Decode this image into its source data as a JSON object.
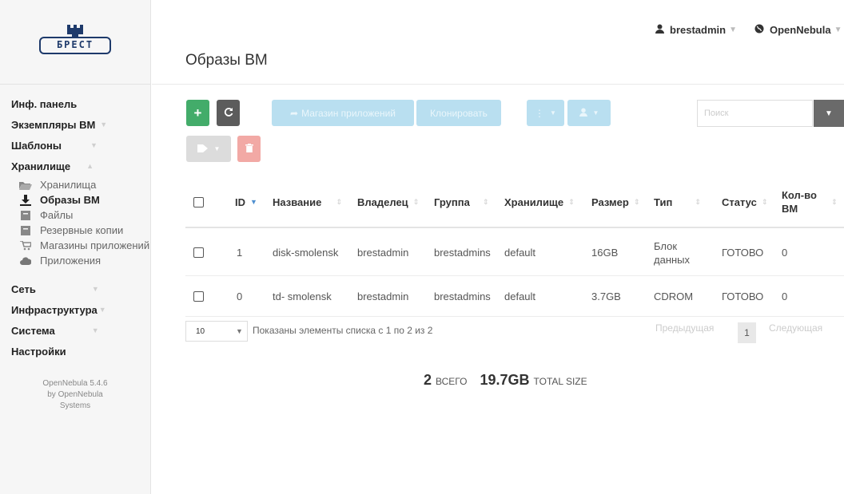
{
  "sidebar": {
    "logo_text": "БРЕСТ",
    "menu": {
      "dashboard": "Инф. панель",
      "vms": "Экземпляры ВМ",
      "templates": "Шаблоны",
      "storage": "Хранилище",
      "network": "Сеть",
      "infrastructure": "Инфраструктура",
      "system": "Система",
      "settings": "Настройки"
    },
    "storage_items": [
      {
        "label": "Хранилища",
        "icon": "folder-open-icon"
      },
      {
        "label": "Образы ВМ",
        "icon": "download-icon"
      },
      {
        "label": "Файлы",
        "icon": "file-icon"
      },
      {
        "label": "Резервные копии",
        "icon": "backup-icon"
      },
      {
        "label": "Магазины приложений",
        "icon": "cart-icon"
      },
      {
        "label": "Приложения",
        "icon": "cloud-icon"
      }
    ],
    "footer": {
      "line1": "OpenNebula 5.4.6",
      "line2": "by OpenNebula",
      "line3": "Systems"
    }
  },
  "header": {
    "title": "Образы ВМ",
    "user": "brestadmin",
    "zone": "OpenNebula"
  },
  "toolbar": {
    "create_label": "+",
    "marketplace_label": "Магазин приложений",
    "clone_label": "Клонировать",
    "search_placeholder": "Поиск"
  },
  "table": {
    "columns": {
      "id": "ID",
      "name": "Название",
      "owner": "Владелец",
      "group": "Группа",
      "datastore": "Хранилище",
      "size": "Размер",
      "type": "Тип",
      "status": "Статус",
      "vms": "Кол-во ВМ"
    },
    "rows": [
      {
        "id": "1",
        "name": "disk-smolensk",
        "owner": "brestadmin",
        "group": "brestadmins",
        "datastore": "default",
        "size": "16GB",
        "type": "Блок данных",
        "status": "ГОТОВО",
        "vms": "0"
      },
      {
        "id": "0",
        "name": "td- smolensk",
        "owner": "brestadmin",
        "group": "brestadmins",
        "datastore": "default",
        "size": "3.7GB",
        "type": "CDROM",
        "status": "ГОТОВО",
        "vms": "0"
      }
    ]
  },
  "pagination": {
    "page_length": "10",
    "info": "Показаны элементы списка с 1 по 2 из 2",
    "previous": "Предыдущая",
    "current": "1",
    "next": "Следующая"
  },
  "totals": {
    "count": "2",
    "count_label": "ВСЕГО",
    "size": "19.7GB",
    "size_label": "TOTAL SIZE"
  },
  "colors": {
    "green": "#43ac6a",
    "dark_gray": "#5c5c5c",
    "light_blue": "#b9dff0",
    "light_red": "#f2a9a5"
  }
}
